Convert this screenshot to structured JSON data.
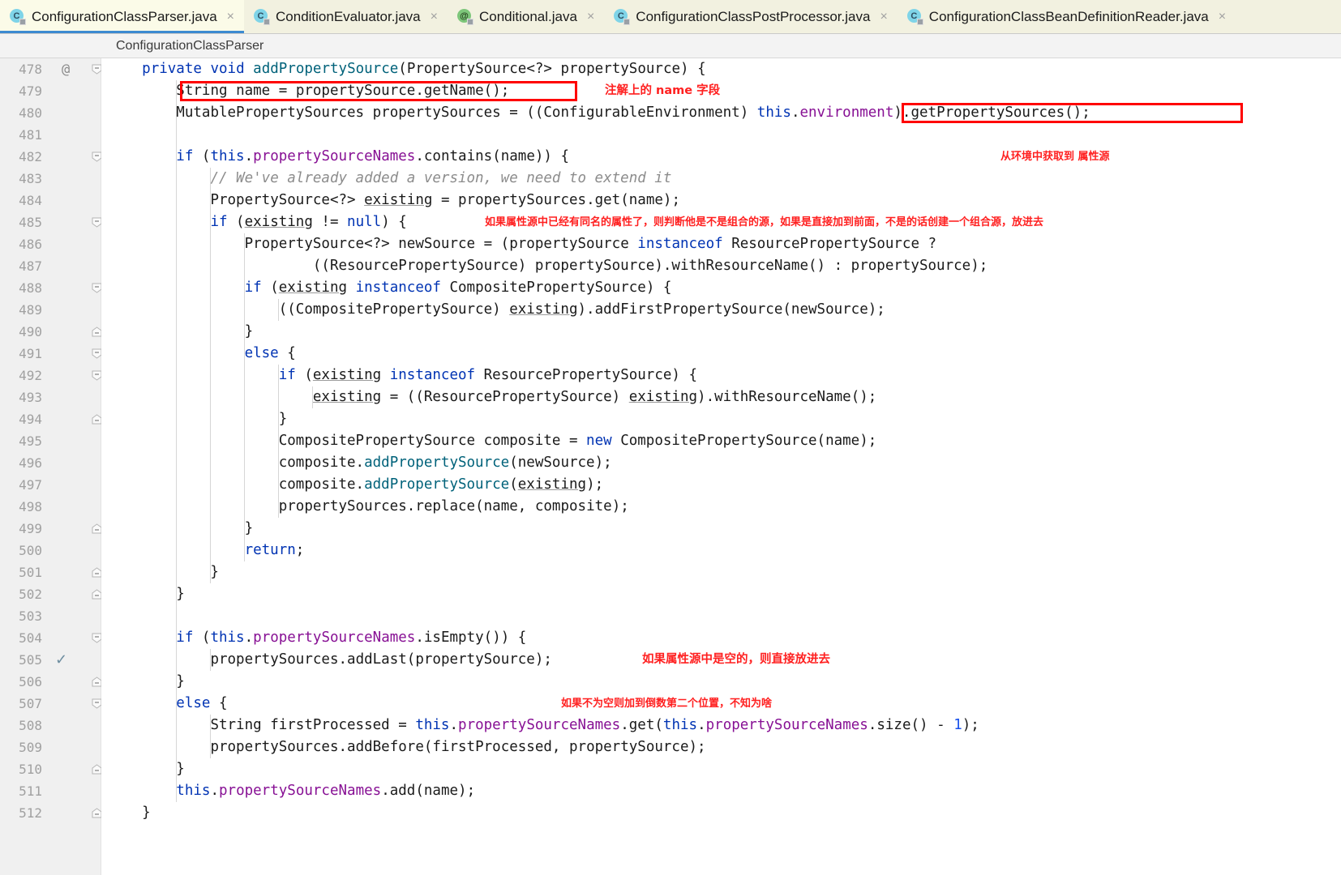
{
  "tabs": [
    {
      "label": "ConfigurationClassParser.java",
      "icon": "java-class-icon",
      "icon_letter": "C",
      "icon_kind": "cls",
      "active": true
    },
    {
      "label": "ConditionEvaluator.java",
      "icon": "java-class-icon",
      "icon_letter": "C",
      "icon_kind": "cls",
      "active": false
    },
    {
      "label": "Conditional.java",
      "icon": "java-annotation-icon",
      "icon_letter": "@",
      "icon_kind": "ann",
      "active": false
    },
    {
      "label": "ConfigurationClassPostProcessor.java",
      "icon": "java-class-icon",
      "icon_letter": "C",
      "icon_kind": "cls",
      "active": false
    },
    {
      "label": "ConfigurationClassBeanDefinitionReader.java",
      "icon": "java-class-icon",
      "icon_letter": "C",
      "icon_kind": "cls",
      "active": false
    }
  ],
  "close_icon": "×",
  "breadcrumb": {
    "text": "ConfigurationClassParser"
  },
  "gutter": {
    "annotation_marker": "@",
    "check_marker": "✓",
    "lines": [
      {
        "n": "478",
        "mark": "@",
        "fold": "start"
      },
      {
        "n": "479",
        "mark": "",
        "fold": ""
      },
      {
        "n": "480",
        "mark": "",
        "fold": ""
      },
      {
        "n": "481",
        "mark": "",
        "fold": ""
      },
      {
        "n": "482",
        "mark": "",
        "fold": "start"
      },
      {
        "n": "483",
        "mark": "",
        "fold": ""
      },
      {
        "n": "484",
        "mark": "",
        "fold": ""
      },
      {
        "n": "485",
        "mark": "",
        "fold": "start"
      },
      {
        "n": "486",
        "mark": "",
        "fold": ""
      },
      {
        "n": "487",
        "mark": "",
        "fold": ""
      },
      {
        "n": "488",
        "mark": "",
        "fold": "start"
      },
      {
        "n": "489",
        "mark": "",
        "fold": ""
      },
      {
        "n": "490",
        "mark": "",
        "fold": "end"
      },
      {
        "n": "491",
        "mark": "",
        "fold": "start"
      },
      {
        "n": "492",
        "mark": "",
        "fold": "start"
      },
      {
        "n": "493",
        "mark": "",
        "fold": ""
      },
      {
        "n": "494",
        "mark": "",
        "fold": "end"
      },
      {
        "n": "495",
        "mark": "",
        "fold": ""
      },
      {
        "n": "496",
        "mark": "",
        "fold": ""
      },
      {
        "n": "497",
        "mark": "",
        "fold": ""
      },
      {
        "n": "498",
        "mark": "",
        "fold": ""
      },
      {
        "n": "499",
        "mark": "",
        "fold": "end"
      },
      {
        "n": "500",
        "mark": "",
        "fold": ""
      },
      {
        "n": "501",
        "mark": "",
        "fold": "end"
      },
      {
        "n": "502",
        "mark": "",
        "fold": "end"
      },
      {
        "n": "503",
        "mark": "",
        "fold": ""
      },
      {
        "n": "504",
        "mark": "",
        "fold": "start"
      },
      {
        "n": "505",
        "mark": "✓",
        "fold": ""
      },
      {
        "n": "506",
        "mark": "",
        "fold": "end"
      },
      {
        "n": "507",
        "mark": "",
        "fold": "start"
      },
      {
        "n": "508",
        "mark": "",
        "fold": ""
      },
      {
        "n": "509",
        "mark": "",
        "fold": ""
      },
      {
        "n": "510",
        "mark": "",
        "fold": "end"
      },
      {
        "n": "511",
        "mark": "",
        "fold": ""
      },
      {
        "n": "512",
        "mark": "",
        "fold": "end"
      }
    ]
  },
  "code": {
    "language": "java",
    "first_line_number": 478,
    "lines": [
      "    private void addPropertySource(PropertySource<?> propertySource) {",
      "        String name = propertySource.getName();",
      "        MutablePropertySources propertySources = ((ConfigurableEnvironment) this.environment).getPropertySources();",
      "",
      "        if (this.propertySourceNames.contains(name)) {",
      "            // We've already added a version, we need to extend it",
      "            PropertySource<?> existing = propertySources.get(name);",
      "            if (existing != null) {",
      "                PropertySource<?> newSource = (propertySource instanceof ResourcePropertySource ?",
      "                        ((ResourcePropertySource) propertySource).withResourceName() : propertySource);",
      "                if (existing instanceof CompositePropertySource) {",
      "                    ((CompositePropertySource) existing).addFirstPropertySource(newSource);",
      "                }",
      "                else {",
      "                    if (existing instanceof ResourcePropertySource) {",
      "                        existing = ((ResourcePropertySource) existing).withResourceName();",
      "                    }",
      "                    CompositePropertySource composite = new CompositePropertySource(name);",
      "                    composite.addPropertySource(newSource);",
      "                    composite.addPropertySource(existing);",
      "                    propertySources.replace(name, composite);",
      "                }",
      "                return;",
      "            }",
      "        }",
      "",
      "        if (this.propertySourceNames.isEmpty()) {",
      "            propertySources.addLast(propertySource);",
      "        }",
      "        else {",
      "            String firstProcessed = this.propertySourceNames.get(this.propertySourceNames.size() - 1);",
      "            propertySources.addBefore(firstProcessed, propertySource);",
      "        }",
      "        this.propertySourceNames.add(name);",
      "    }"
    ]
  },
  "annotations": [
    {
      "line": 479,
      "text": "注解上的 name 字段",
      "color": "#ff2020"
    },
    {
      "line": 482,
      "text": "从环境中获取到 属性源",
      "color": "#ff2020"
    },
    {
      "line": 485,
      "text": "如果属性源中已经有同名的属性了，则判断他是不是组合的源，如果是直接加到前面，不是的话创建一个组合源，放进去",
      "color": "#ff2020"
    },
    {
      "line": 505,
      "text": "如果属性源中是空的，则直接放进去",
      "color": "#ff2020"
    },
    {
      "line": 507,
      "text": "如果不为空则加到倒数第二个位置，不知为啥",
      "color": "#ff2020"
    }
  ],
  "highlight_boxes": [
    {
      "name": "string-name-highlight",
      "line": 479,
      "code_fragment": "String name = propertySource.getName();"
    },
    {
      "name": "environment-highlight",
      "line": 480,
      "code_fragment": "environment).getPropertySources();"
    }
  ],
  "colors": {
    "tab_active_bg": "#fbfbe8",
    "tab_bg": "#f2f1e0",
    "tab_underline": "#3c8ad1",
    "gutter_bg": "#f0f0f0",
    "editor_bg": "#ffffff",
    "keyword": "#0033b3",
    "field": "#871094",
    "method": "#00627a",
    "comment": "#8c8c8c",
    "number": "#1750eb",
    "annotation_red": "#ff2020",
    "highlight_box": "#ff0000"
  }
}
